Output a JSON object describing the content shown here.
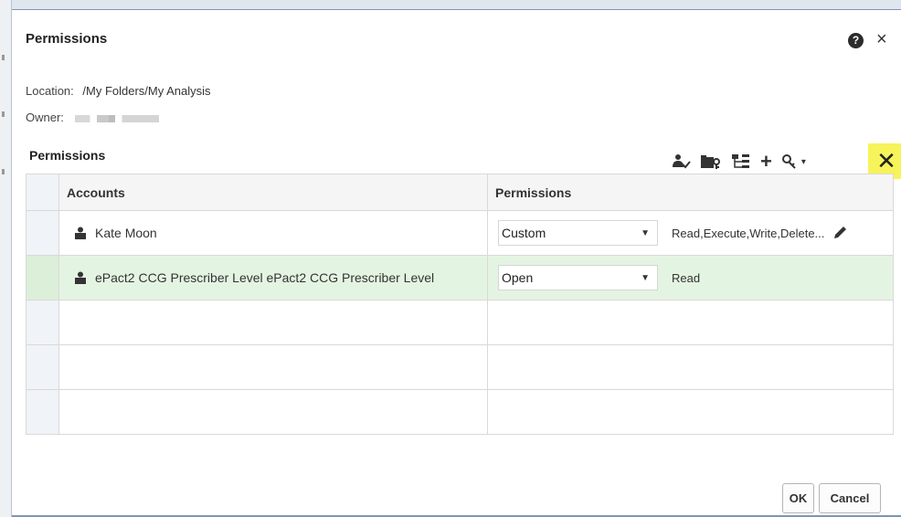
{
  "dialog": {
    "title": "Permissions",
    "help_glyph": "?",
    "close_glyph": "×"
  },
  "info": {
    "location_label": "Location:",
    "location_value": "/My Folders/My Analysis",
    "owner_label": "Owner:"
  },
  "section": {
    "title": "Permissions"
  },
  "toolbar": {
    "icons": [
      "add-users-icon",
      "folder-key-icon",
      "hierarchy-icon",
      "plus-icon",
      "key-dropdown-icon",
      "delete-icon"
    ],
    "plus_glyph": "+",
    "delete_glyph": "✕",
    "caret_glyph": "▾"
  },
  "table": {
    "headers": [
      "Accounts",
      "Permissions"
    ],
    "rows": [
      {
        "account": "Kate Moon",
        "permission": "Custom",
        "detail": "Read,Execute,Write,Delete..."
      },
      {
        "account": "ePact2 CCG Prescriber Level ePact2 CCG Prescriber Level",
        "permission": "Open",
        "detail": "Read"
      }
    ],
    "empty_rows": 3
  },
  "footer": {
    "ok_label": "OK",
    "cancel_label": "Cancel"
  },
  "colors": {
    "selected_row_bg": "#e4f4e2",
    "highlight_button_bg": "#f7f35a"
  }
}
